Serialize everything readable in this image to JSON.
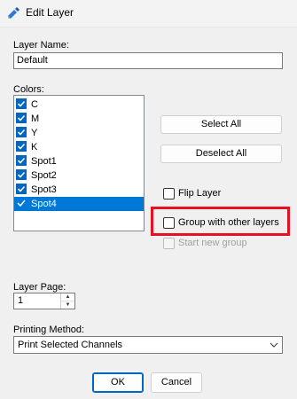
{
  "window": {
    "title": "Edit Layer"
  },
  "layer_name": {
    "label": "Layer Name:",
    "value": "Default"
  },
  "colors": {
    "label": "Colors:",
    "items": [
      {
        "label": "C",
        "checked": true
      },
      {
        "label": "M",
        "checked": true
      },
      {
        "label": "Y",
        "checked": true
      },
      {
        "label": "K",
        "checked": true
      },
      {
        "label": "Spot1",
        "checked": true
      },
      {
        "label": "Spot2",
        "checked": true
      },
      {
        "label": "Spot3",
        "checked": true
      },
      {
        "label": "Spot4",
        "checked": true,
        "selected": true
      }
    ]
  },
  "buttons": {
    "select_all": "Select All",
    "deselect_all": "Deselect All",
    "ok": "OK",
    "cancel": "Cancel"
  },
  "options": {
    "flip_layer": {
      "label": "Flip Layer",
      "checked": false
    },
    "group_with_other_layers": {
      "label": "Group with other layers",
      "checked": false
    },
    "start_new_group": {
      "label": "Start new group",
      "checked": false,
      "disabled": true
    }
  },
  "layer_page": {
    "label": "Layer Page:",
    "value": "1"
  },
  "printing_method": {
    "label": "Printing Method:",
    "value": "Print Selected Channels"
  },
  "colors_palette": {
    "accent": "#0067c0",
    "selection": "#0078d7",
    "highlight": "#e81123"
  }
}
